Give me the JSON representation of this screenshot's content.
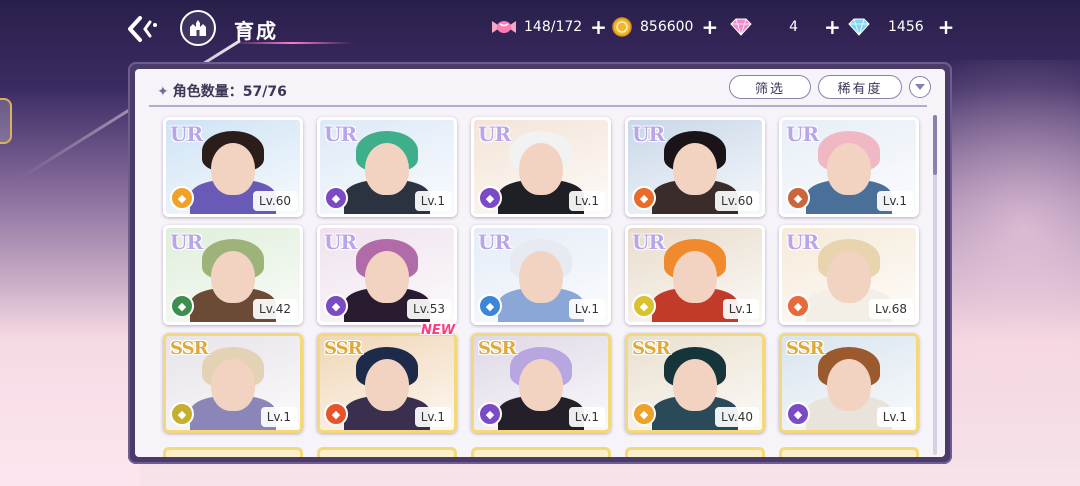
{
  "header": {
    "title": "育成",
    "resources": [
      {
        "icon": "candy-icon",
        "value": "148/172"
      },
      {
        "icon": "coin-icon",
        "value": "856600"
      },
      {
        "icon": "pink-diamond-icon",
        "value": "4"
      },
      {
        "icon": "blue-diamond-icon",
        "value": "1456"
      }
    ]
  },
  "panel": {
    "count_label": "角色数量：57/76",
    "filter_label": "筛选",
    "rarity_label": "稀有度"
  },
  "cards": [
    {
      "rank": "UR",
      "level": "Lv.60",
      "element_color": "#f0a12a",
      "hair": "#2b1d1a",
      "outfit": "#6a5ab8",
      "bg": "#cfe3f5"
    },
    {
      "rank": "UR",
      "level": "Lv.1",
      "element_color": "#7a4bc4",
      "hair": "#3fae8a",
      "outfit": "#2c3340",
      "bg": "#dde9f7"
    },
    {
      "rank": "UR",
      "level": "Lv.1",
      "element_color": "#7a4bc4",
      "hair": "#f2f2f2",
      "outfit": "#1f1f26",
      "bg": "#f3e4d7"
    },
    {
      "rank": "UR",
      "level": "Lv.60",
      "element_color": "#ea6a2a",
      "hair": "#1a1418",
      "outfit": "#3a2c2a",
      "bg": "#c9d7e8"
    },
    {
      "rank": "UR",
      "level": "Lv.1",
      "element_color": "#c8673a",
      "hair": "#f0b8c4",
      "outfit": "#4a6f98",
      "bg": "#e7eef7"
    },
    {
      "rank": "UR",
      "level": "Lv.42",
      "element_color": "#3c8f4e",
      "hair": "#9db37a",
      "outfit": "#6b4a36",
      "bg": "#dfeeda"
    },
    {
      "rank": "UR",
      "level": "Lv.53",
      "element_color": "#7a4bc4",
      "hair": "#b06ba8",
      "outfit": "#2a1c30",
      "bg": "#efe2ee"
    },
    {
      "rank": "UR",
      "level": "Lv.1",
      "element_color": "#3a86d8",
      "hair": "#e8eaf2",
      "outfit": "#8aa7d8",
      "bg": "#e4ecf7"
    },
    {
      "rank": "UR",
      "level": "Lv.1",
      "element_color": "#d9c22e",
      "hair": "#f08a2c",
      "outfit": "#c23b2a",
      "bg": "#e8dccc"
    },
    {
      "rank": "UR",
      "level": "Lv.68",
      "element_color": "#e86a3a",
      "hair": "#e9d4b0",
      "outfit": "#f3efe7",
      "bg": "#f6ead9"
    },
    {
      "rank": "SSR",
      "level": "Lv.1",
      "element_color": "#c4b02e",
      "hair": "#e3d2b4",
      "outfit": "#8a86b8",
      "bg": "#e7e3ea"
    },
    {
      "rank": "SSR",
      "level": "Lv.1",
      "element_color": "#e8532a",
      "hair": "#1d2a4a",
      "outfit": "#3a2f4e",
      "bg": "#f0d6b6",
      "new": "NEW"
    },
    {
      "rank": "SSR",
      "level": "Lv.1",
      "element_color": "#7a4bc4",
      "hair": "#b8a6e0",
      "outfit": "#232029",
      "bg": "#dfd8e6"
    },
    {
      "rank": "SSR",
      "level": "Lv.40",
      "element_color": "#f0a12a",
      "hair": "#15353a",
      "outfit": "#2a4a5a",
      "bg": "#e9e0cf"
    },
    {
      "rank": "SSR",
      "level": "Lv.1",
      "element_color": "#7a4bc4",
      "hair": "#9a5a2e",
      "outfit": "#e8e4dc",
      "bg": "#d9e4ee"
    }
  ]
}
